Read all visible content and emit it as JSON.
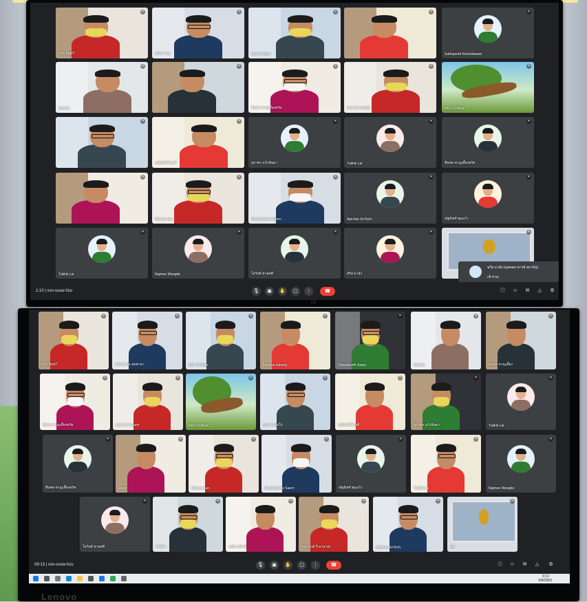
{
  "top_meeting": {
    "time_code": "1:10 | vsn-ssuw-hzu",
    "tiles": [
      {
        "name": "ครับ Best?",
        "kind": "person"
      },
      {
        "name": "นภัสวรรณ",
        "kind": "person"
      },
      {
        "name": "Intro To Beer",
        "kind": "person"
      },
      {
        "name": "",
        "kind": "person"
      },
      {
        "name": "Sathapond Kinchekawat",
        "kind": "avatar"
      },
      {
        "name": "Sak Ea",
        "kind": "person"
      },
      {
        "name": "",
        "kind": "person"
      },
      {
        "name": "ทีมพล ชาญเลี้ยงทรัพ",
        "kind": "person"
      },
      {
        "name": "อรุณ สุวรรณสุข",
        "kind": "person"
      },
      {
        "name": "Intro To Beer",
        "kind": "scene"
      },
      {
        "name": "",
        "kind": "person"
      },
      {
        "name": "เฉลิมศักดิ์ มุ่งดี",
        "kind": "person"
      },
      {
        "name": "สุภาพร แก้วจินดา",
        "kind": "avatar"
      },
      {
        "name": "Tukkik Lai",
        "kind": "avatar"
      },
      {
        "name": "ทีมพล ชาญเลี้ยงทรัพ",
        "kind": "avatar"
      },
      {
        "name": "",
        "kind": "person"
      },
      {
        "name": "Haroun aun",
        "kind": "person"
      },
      {
        "name": "Graciemaree Saern",
        "kind": "person"
      },
      {
        "name": "Apichan EnTech.",
        "kind": "avatar"
      },
      {
        "name": "ณัฐนิชท์ ชุมแก้ว",
        "kind": "avatar"
      },
      {
        "name": "Tukkik Lai",
        "kind": "avatar"
      },
      {
        "name": "Najmee Wangde",
        "kind": "avatar"
      },
      {
        "name": "โอวิทย์ ชาลดที",
        "kind": "avatar"
      },
      {
        "name": "ศรีส มาลัง",
        "kind": "avatar"
      },
      {
        "name": "",
        "kind": "presentation"
      }
    ],
    "speaker_label": "ฉวีล มาลัง (บุคคลอาจารย์ สถาบัน)",
    "speaker_sub": "เข้าร่วม",
    "brand": "LG"
  },
  "bottom_meeting": {
    "time_code": "09:13 | vsn-ssuw-hzu",
    "tiles": [
      {
        "name": "ครับ Best?",
        "kind": "person"
      },
      {
        "name": "นภัสวรรณ ชมพาสา",
        "kind": "person"
      },
      {
        "name": "Intro To Beer",
        "kind": "person"
      },
      {
        "name": "kanchai taloong",
        "kind": "person"
      },
      {
        "name": "Chayaworth Saejo",
        "kind": "person"
      },
      {
        "name": "Sak Ea",
        "kind": "person"
      },
      {
        "name": "ธนพล ชาญเลี้ยง",
        "kind": "person"
      },
      {
        "name": "ทีมพล ชาญเลี้ยงทรัพ",
        "kind": "person"
      },
      {
        "name": "อรุณ สุวรรณสุข",
        "kind": "person"
      },
      {
        "name": "Intro To Beer",
        "kind": "scene"
      },
      {
        "name": "ญาดา ทองใบ",
        "kind": "person"
      },
      {
        "name": "เฉลิมศักดิ์ มุ่งดี",
        "kind": "person"
      },
      {
        "name": "สุภาพร แก้วจินดา",
        "kind": "person"
      },
      {
        "name": "Tukkik Lai",
        "kind": "avatar"
      },
      {
        "name": "ทีมพล ชาญเลี้ยงทรัพ",
        "kind": "avatar"
      },
      {
        "name": "ewer",
        "kind": "person"
      },
      {
        "name": "Haroun aun",
        "kind": "person"
      },
      {
        "name": "Graciemaree Saern",
        "kind": "person"
      },
      {
        "name": "ณัฐนิชท์ ชุมแก้ว",
        "kind": "avatar"
      },
      {
        "name": "Tukkik Lai",
        "kind": "person"
      },
      {
        "name": "Najmee Wangde",
        "kind": "avatar"
      },
      {
        "name": "โอวิทย์ ชาลดที",
        "kind": "avatar"
      },
      {
        "name": "ชาลิสา",
        "kind": "person"
      },
      {
        "name": "เฉลิม เกียรติ",
        "kind": "person"
      },
      {
        "name": "ชนกานต์ ปี มาลาสะ",
        "kind": "person"
      },
      {
        "name": "Apichan EnTech.",
        "kind": "person"
      },
      {
        "name": "ศุภ",
        "kind": "presentation"
      }
    ],
    "clock": "9:13",
    "date": "6/8/2563",
    "brand": "Lenovo"
  }
}
